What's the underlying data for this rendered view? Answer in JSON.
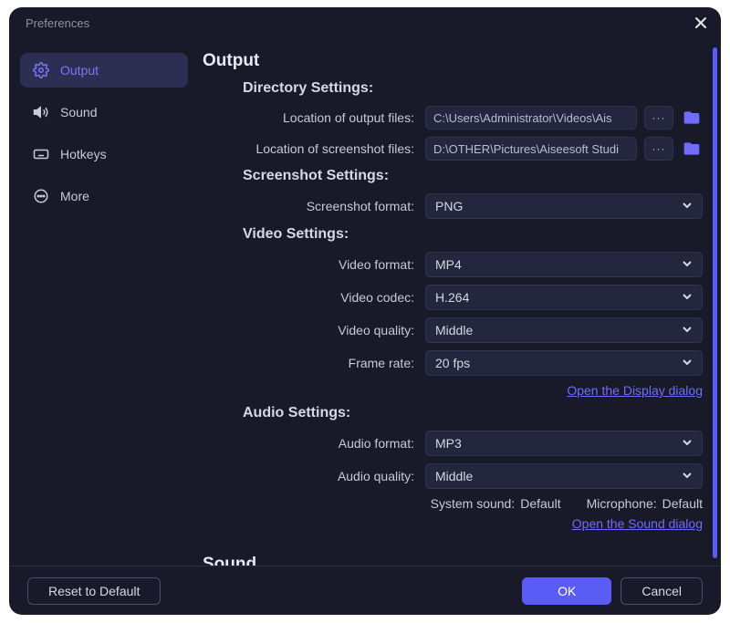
{
  "window": {
    "title": "Preferences"
  },
  "sidebar": {
    "items": [
      {
        "label": "Output"
      },
      {
        "label": "Sound"
      },
      {
        "label": "Hotkeys"
      },
      {
        "label": "More"
      }
    ]
  },
  "sections": {
    "output_title": "Output",
    "sound_title": "Sound",
    "directory": {
      "heading": "Directory Settings:",
      "output_files_label": "Location of output files:",
      "output_files_value": "C:\\Users\\Administrator\\Videos\\Ais",
      "screenshot_files_label": "Location of screenshot files:",
      "screenshot_files_value": "D:\\OTHER\\Pictures\\Aiseesoft Studi"
    },
    "screenshot": {
      "heading": "Screenshot Settings:",
      "format_label": "Screenshot format:",
      "format_value": "PNG"
    },
    "video": {
      "heading": "Video Settings:",
      "format_label": "Video format:",
      "format_value": "MP4",
      "codec_label": "Video codec:",
      "codec_value": "H.264",
      "quality_label": "Video quality:",
      "quality_value": "Middle",
      "framerate_label": "Frame rate:",
      "framerate_value": "20 fps",
      "display_link": "Open the Display dialog"
    },
    "audio": {
      "heading": "Audio Settings:",
      "format_label": "Audio format:",
      "format_value": "MP3",
      "quality_label": "Audio quality:",
      "quality_value": "Middle",
      "system_sound_label": "System sound:",
      "system_sound_value": "Default",
      "microphone_label": "Microphone:",
      "microphone_value": "Default",
      "sound_link": "Open the Sound dialog"
    }
  },
  "footer": {
    "reset": "Reset to Default",
    "ok": "OK",
    "cancel": "Cancel"
  },
  "glyphs": {
    "ellipsis": "···"
  }
}
